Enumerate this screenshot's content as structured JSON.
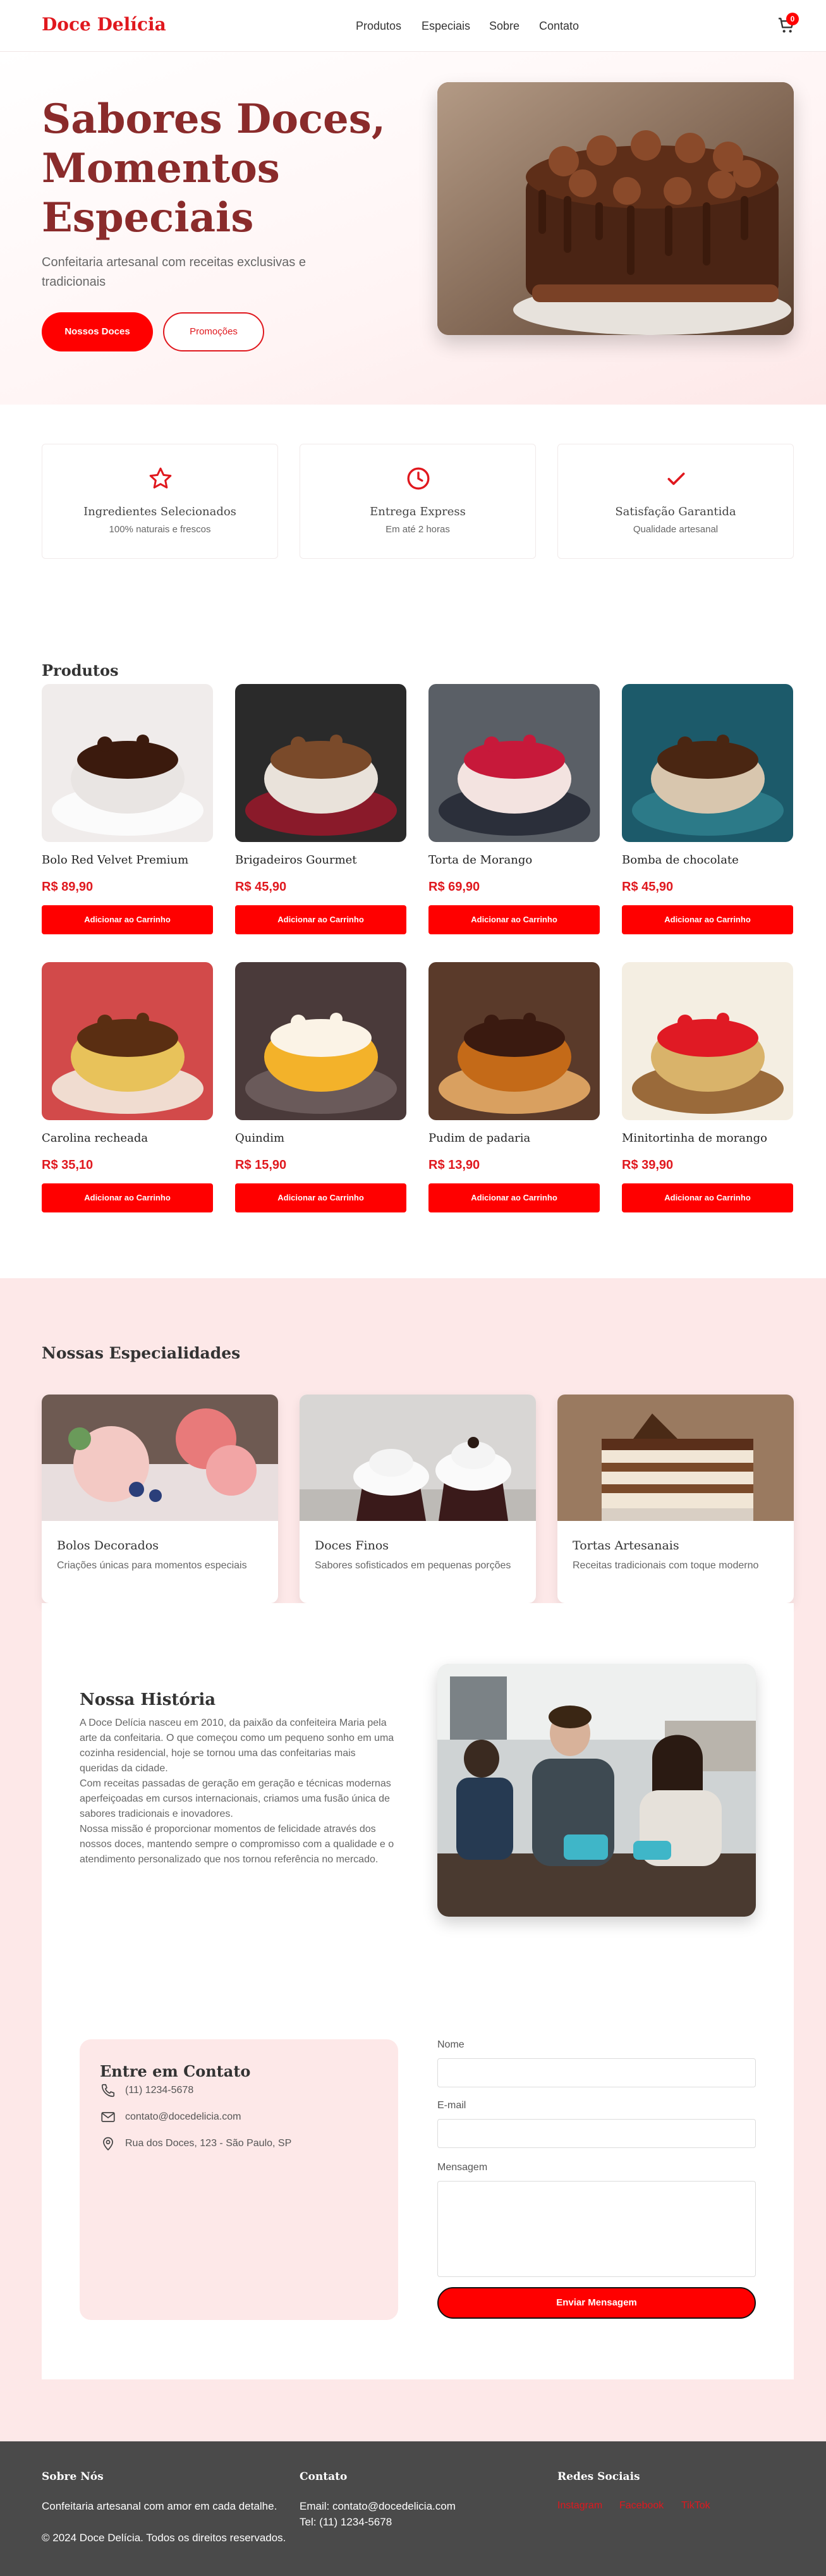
{
  "nav": {
    "brand": "Doce Delícia",
    "links": [
      "Produtos",
      "Especiais",
      "Sobre",
      "Contato"
    ],
    "cart_count": "0"
  },
  "hero": {
    "title": "Sabores Doces, Momentos Especiais",
    "subtitle": "Confeitaria artesanal com receitas exclusivas e tradicionais",
    "primary_button": "Nossos Doces",
    "secondary_button": "Promoções"
  },
  "features": [
    {
      "icon": "star-icon",
      "title": "Ingredientes Selecionados",
      "subtitle": "100% naturais e frescos"
    },
    {
      "icon": "clock-icon",
      "title": "Entrega Express",
      "subtitle": "Em até 2 horas"
    },
    {
      "icon": "check-icon",
      "title": "Satisfação Garantida",
      "subtitle": "Qualidade artesanal"
    }
  ],
  "products": {
    "title": "Produtos",
    "add_label": "Adicionar ao Carrinho",
    "items": [
      {
        "name": "Bolo Red Velvet Premium",
        "price": "R$ 89,90"
      },
      {
        "name": "Brigadeiros Gourmet",
        "price": "R$ 45,90"
      },
      {
        "name": "Torta de Morango",
        "price": "R$ 69,90"
      },
      {
        "name": "Bomba de chocolate",
        "price": "R$ 45,90"
      },
      {
        "name": "Carolina recheada",
        "price": "R$ 35,10"
      },
      {
        "name": "Quindim",
        "price": "R$ 15,90"
      },
      {
        "name": "Pudim de padaria",
        "price": "R$ 13,90"
      },
      {
        "name": "Minitortinha de morango",
        "price": "R$ 39,90"
      }
    ]
  },
  "specialties": {
    "title": "Nossas Especialidades",
    "items": [
      {
        "title": "Bolos Decorados",
        "desc": "Criações únicas para momentos especiais"
      },
      {
        "title": "Doces Finos",
        "desc": "Sabores sofisticados em pequenas porções"
      },
      {
        "title": "Tortas Artesanais",
        "desc": "Receitas tradicionais com toque moderno"
      }
    ]
  },
  "story": {
    "title": "Nossa História",
    "text": "A Doce Delícia nasceu em 2010, da paixão da confeiteira Maria pela arte da confeitaria. O que começou como um pequeno sonho em uma cozinha residencial, hoje se tornou uma das confeitarias mais queridas da cidade.\nCom receitas passadas de geração em geração e técnicas modernas aperfeiçoadas em cursos internacionais, criamos uma fusão única de sabores tradicionais e inovadores.\nNossa missão é proporcionar momentos de felicidade através dos nossos doces, mantendo sempre o compromisso com a qualidade e o atendimento personalizado que nos tornou referência no mercado."
  },
  "contact": {
    "title": "Entre em Contato",
    "phone": "(11) 1234-5678",
    "email": "contato@docedelicia.com",
    "address": "Rua dos Doces, 123 - São Paulo, SP",
    "form": {
      "name_label": "Nome",
      "email_label": "E-mail",
      "message_label": "Mensagem",
      "submit": "Enviar Mensagem"
    }
  },
  "footer": {
    "about_title": "Sobre Nós",
    "about_text": "Confeitaria artesanal com amor em cada detalhe.",
    "copyright": "© 2024 Doce Delícia. Todos os direitos reservados.",
    "contact_title": "Contato",
    "contact_email": "Email: contato@docedelicia.com",
    "contact_phone": "Tel: (11) 1234-5678",
    "social_title": "Redes Sociais",
    "social": [
      "Instagram",
      "Facebook",
      "TikTok"
    ]
  },
  "colors": {
    "accent": "#ff0000",
    "brand": "#e0181e",
    "hero_title": "#8a2b2b",
    "pink_bg": "#fde8e8",
    "footer_bg": "#4a4a4a"
  }
}
